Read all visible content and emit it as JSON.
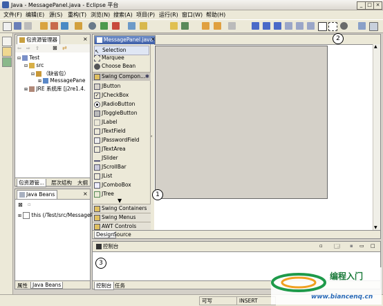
{
  "window": {
    "title": "Java - MessagePanel.java - Eclipse 平台"
  },
  "menu": [
    "文件(F)",
    "编辑(E)",
    "源(S)",
    "重构(T)",
    "浏览(N)",
    "搜索(A)",
    "项目(P)",
    "运行(R)",
    "窗口(W)",
    "帮助(H)"
  ],
  "package_explorer": {
    "tab_label": "包资源管理器",
    "tree": [
      "Test",
      "src",
      "（缺省包）",
      "MessagePane",
      "JRE 系统库 [j2re1.4."
    ],
    "bottom_tabs": [
      "包资源管...",
      "层次结构",
      "大纲"
    ]
  },
  "java_beans": {
    "tab_label": "Java Beans",
    "tree_item": "this (/Test/src/MessagePa",
    "bottom_tabs": [
      "属性",
      "Java Beans"
    ]
  },
  "editor": {
    "tab_label": "MessagePanel.java",
    "bottom_tabs": [
      "Design",
      "Source"
    ]
  },
  "palette": {
    "tools": [
      "Selection",
      "Marquee",
      "Choose Bean"
    ],
    "category_open": "Swing Compon...",
    "components": [
      "JButton",
      "JCheckBox",
      "JRadioButton",
      "JToggleButton",
      "JLabel",
      "JTextField",
      "JPasswordField",
      "JTextArea",
      "JSlider",
      "JScrollBar",
      "JList",
      "JComboBox",
      "JTree"
    ],
    "categories": [
      "Swing Containers",
      "Swing Menus",
      "AWT Controls"
    ]
  },
  "console": {
    "tab_label": "控制台",
    "bottom_tabs": [
      "控制台",
      "任务"
    ]
  },
  "callouts": [
    "1",
    "2",
    "3"
  ],
  "status": {
    "writable": "可写",
    "mode": "INSERT"
  },
  "watermark": {
    "text": "编程入门",
    "url": "www.biancenq.cn"
  }
}
